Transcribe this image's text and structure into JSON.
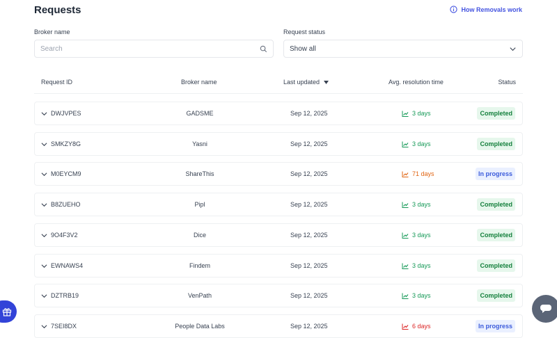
{
  "page": {
    "title": "Requests",
    "help_link": "How Removals work"
  },
  "filters": {
    "broker_label": "Broker name",
    "search_placeholder": "Search",
    "status_label": "Request status",
    "status_value": "Show all"
  },
  "table": {
    "headers": {
      "request_id": "Request ID",
      "broker_name": "Broker name",
      "last_updated": "Last updated",
      "avg_resolution": "Avg. resolution time",
      "status": "Status"
    },
    "rows": [
      {
        "id": "DWJVPES",
        "broker": "GADSME",
        "updated": "Sep 12, 2025",
        "avg": "3 days",
        "avg_level": "good",
        "status": "Completed"
      },
      {
        "id": "SMKZY8G",
        "broker": "Yasni",
        "updated": "Sep 12, 2025",
        "avg": "3 days",
        "avg_level": "good",
        "status": "Completed"
      },
      {
        "id": "M0EYCM9",
        "broker": "ShareThis",
        "updated": "Sep 12, 2025",
        "avg": "71 days",
        "avg_level": "warn",
        "status": "In progress"
      },
      {
        "id": "B8ZUEHO",
        "broker": "Pipl",
        "updated": "Sep 12, 2025",
        "avg": "3 days",
        "avg_level": "good",
        "status": "Completed"
      },
      {
        "id": "9O4F3V2",
        "broker": "Dice",
        "updated": "Sep 12, 2025",
        "avg": "3 days",
        "avg_level": "good",
        "status": "Completed"
      },
      {
        "id": "EWNAWS4",
        "broker": "Findem",
        "updated": "Sep 12, 2025",
        "avg": "3 days",
        "avg_level": "good",
        "status": "Completed"
      },
      {
        "id": "DZTRB19",
        "broker": "VenPath",
        "updated": "Sep 12, 2025",
        "avg": "3 days",
        "avg_level": "good",
        "status": "Completed"
      },
      {
        "id": "7SEI8DX",
        "broker": "People Data Labs",
        "updated": "Sep 12, 2025",
        "avg": "6 days",
        "avg_level": "bad",
        "status": "In progress"
      }
    ]
  },
  "colors": {
    "accent": "#4353e0",
    "completed_text": "#15803d",
    "completed_bg": "#e6f7ec",
    "progress_text": "#3b5bdb",
    "progress_bg": "#eaf0ff",
    "avg_good": "#159957",
    "avg_warn": "#e06412",
    "avg_bad": "#dc2626"
  },
  "icons": [
    "info-icon",
    "search-icon",
    "chevron-down-icon",
    "sort-desc-icon",
    "trend-icon",
    "gift-icon",
    "chat-icon"
  ]
}
